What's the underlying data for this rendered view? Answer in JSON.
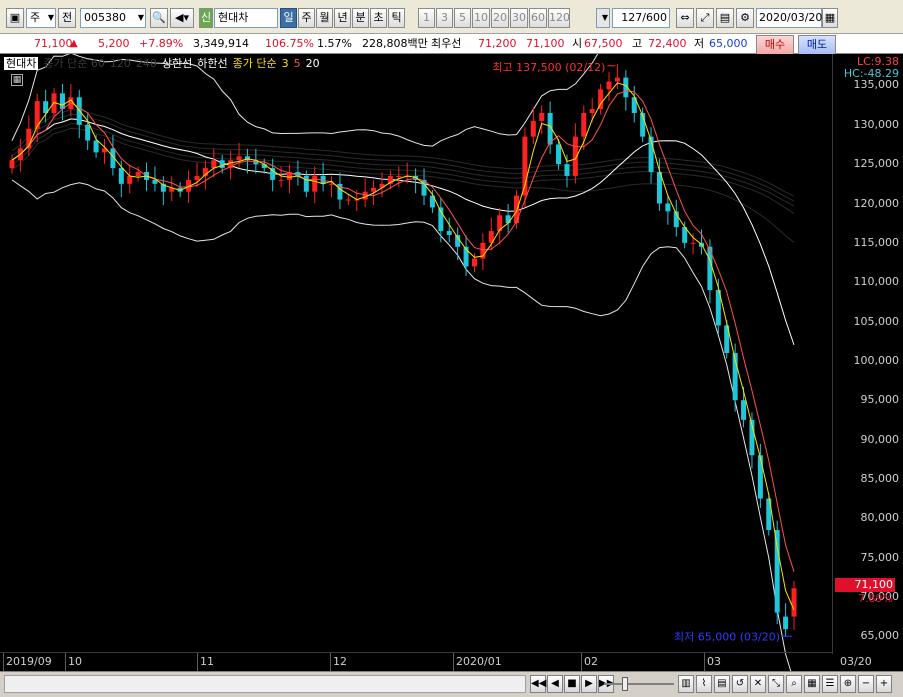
{
  "toolbar": {
    "market_label": "주",
    "prefix_label": "전",
    "code_value": "005380",
    "stock_badge": "신",
    "stock_name": "현대차",
    "periods": [
      "일",
      "주",
      "월",
      "년",
      "분",
      "초",
      "틱"
    ],
    "intervals": [
      "1",
      "3",
      "5",
      "10",
      "20",
      "30",
      "60",
      "120"
    ],
    "count_value": "127",
    "count_total": "/600",
    "date_value": "2020/03/20"
  },
  "info": {
    "price": "71,100",
    "change": "5,200",
    "change_pct": "+7.89%",
    "volume": "3,349,914",
    "vol_ratio": "106.75%",
    "turnover": "1.57%",
    "amount": "228,808백만",
    "best_bid_label": "최우선",
    "best_ask": "71,200",
    "best_bid": "71,100",
    "open_label": "시",
    "open": "67,500",
    "high_label": "고",
    "high": "72,400",
    "low_label": "저",
    "low": "65,000",
    "buy_label": "매수",
    "sell_label": "매도"
  },
  "chart_data": {
    "type": "candlestick",
    "title": "현대차",
    "legend": [
      {
        "label": "현대차",
        "color": "#ffffff"
      },
      {
        "label": "종가 단순 60",
        "color": "#3a3a3a"
      },
      {
        "label": "120",
        "color": "#3a3a3a"
      },
      {
        "label": "240",
        "color": "#3a3a3a"
      },
      {
        "label": "상한선",
        "color": "#ffffff"
      },
      {
        "label": "하한선",
        "color": "#ffffff"
      },
      {
        "label": "종가 단순",
        "color": "#ffe000"
      },
      {
        "label": "3",
        "color": "#ffe000"
      },
      {
        "label": "5",
        "color": "#ff5050"
      },
      {
        "label": "20",
        "color": "#ffffff"
      }
    ],
    "y_ticks": [
      "135,000",
      "130,000",
      "125,000",
      "120,000",
      "115,000",
      "110,000",
      "105,000",
      "100,000",
      "95,000",
      "90,000",
      "85,000",
      "80,000",
      "75,000",
      "70,000",
      "65,000"
    ],
    "ylim": [
      63000,
      139000
    ],
    "x_labels": [
      "2019/09",
      "10",
      "11",
      "12",
      "2020/01",
      "02",
      "03",
      "03/20"
    ],
    "high_annotation": "최고 137,500 (02/12)",
    "low_annotation": "최저 65,000 (03/20)",
    "indicator_top": "LC:9.38",
    "indicator_bottom": "HC:-48.29",
    "last_price": "71,100",
    "last_pct": "7.89%",
    "closes": [
      125500,
      127000,
      129500,
      133000,
      131500,
      134000,
      132000,
      133500,
      130000,
      128000,
      126500,
      127000,
      124500,
      122500,
      123500,
      124000,
      123000,
      122500,
      121500,
      122000,
      121500,
      123000,
      123500,
      124500,
      125500,
      124500,
      125500,
      126000,
      125500,
      125000,
      124500,
      123000,
      123000,
      124000,
      123500,
      121500,
      123500,
      122500,
      122500,
      120500,
      120500,
      120500,
      121500,
      122000,
      122500,
      123500,
      123500,
      123500,
      123000,
      121000,
      119500,
      116500,
      116000,
      114500,
      112000,
      113000,
      115000,
      116500,
      118500,
      117500,
      121000,
      128500,
      130500,
      131500,
      127500,
      125000,
      123500,
      128500,
      131500,
      132000,
      134500,
      135500,
      136000,
      133500,
      131500,
      128500,
      124000,
      120000,
      119000,
      117000,
      115000,
      115000,
      114500,
      109000,
      104500,
      101000,
      95000,
      92500,
      88000,
      82500,
      78500,
      68000,
      65900,
      71100
    ],
    "opens": [
      124500,
      125500,
      127000,
      129500,
      133000,
      131500,
      134000,
      132000,
      133500,
      130000,
      128000,
      126500,
      127000,
      124500,
      122500,
      123500,
      124000,
      123000,
      122500,
      121500,
      122000,
      121500,
      123000,
      123500,
      124500,
      125500,
      124500,
      125500,
      126000,
      125500,
      125000,
      124500,
      123000,
      123000,
      124000,
      123500,
      121500,
      123500,
      122500,
      122500,
      120500,
      120500,
      120500,
      121500,
      122000,
      122500,
      123500,
      123500,
      123500,
      123000,
      121000,
      119500,
      116500,
      116000,
      114500,
      112000,
      113000,
      115000,
      116500,
      118500,
      117500,
      121000,
      128500,
      130500,
      131500,
      127500,
      125000,
      123500,
      128500,
      131500,
      132000,
      134500,
      135500,
      136000,
      133500,
      131500,
      128500,
      124000,
      120000,
      119000,
      117000,
      115000,
      115000,
      114500,
      109000,
      104500,
      101000,
      95000,
      92500,
      88000,
      82500,
      78500,
      67500,
      67500
    ]
  },
  "scrollbar": {
    "buttons": [
      "◀◀",
      "◀",
      "■",
      "▶",
      "▶▶"
    ]
  }
}
